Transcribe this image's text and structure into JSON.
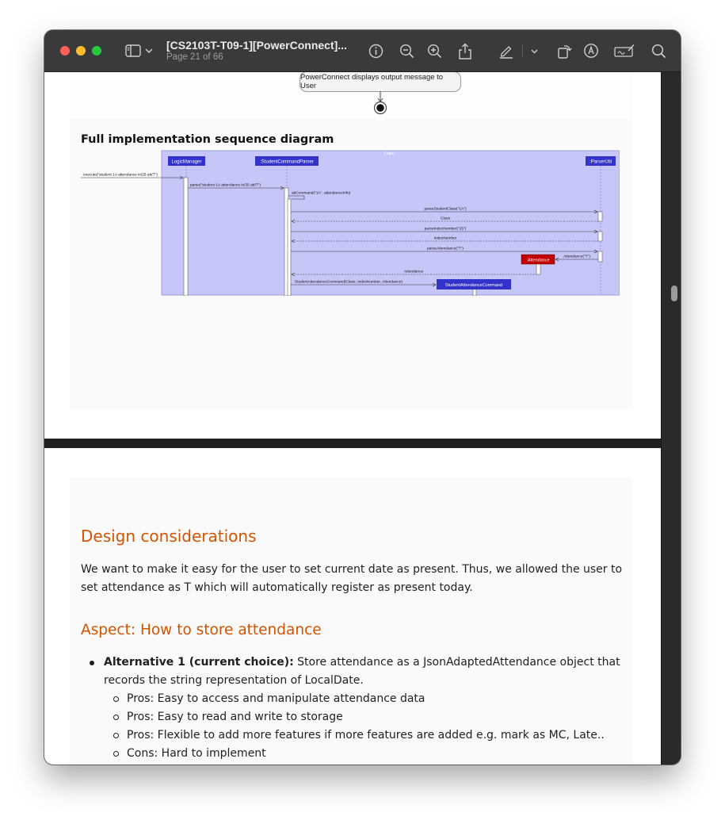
{
  "window": {
    "title": "[CS2103T-T09-1][PowerConnect]...",
    "subtitle": "Page 21 of 66"
  },
  "toolbar": {
    "icons": [
      "sidebar-icon",
      "chevron-down-icon",
      "info-icon",
      "zoom-out-icon",
      "zoom-in-icon",
      "share-icon",
      "highlight-pen-icon",
      "chevron-down-icon",
      "rotate-icon",
      "markup-icon",
      "signature-icon",
      "search-icon"
    ]
  },
  "page1": {
    "activity_node": "PowerConnect displays output message to User",
    "heading": "Full implementation sequence diagram"
  },
  "sequence": {
    "frame_label": "Logic",
    "participants": [
      "LogicManager",
      ":StudentCommandParser",
      ":ParserUtil"
    ],
    "messages": [
      "execute(\"student 1A attendance in/25 att/T\")",
      "parse(\"student 1A attendance in/25 att/T\")",
      "attCommand(\"1A\", attendanceInfo)",
      "parseStudentClass(\"1A\")",
      "Class",
      "parseIndexNumber(\"25\")",
      "IndexNumber",
      "parseAttendance(\"T\")",
      "Attendance(\"T\")",
      "Attendance",
      "StudentAttendanceCommand(Class, IndexNumber, Attendance)"
    ],
    "created_objects": [
      ":Attendance",
      "StudentAttendanceCommand"
    ]
  },
  "page2": {
    "section_heading": "Design considerations",
    "intro": "We want to make it easy for the user to set current date as present. Thus, we allowed the user to set attendance as T which will automatically register as present today.",
    "aspect_heading": "Aspect: How to store attendance",
    "alternative_label": "Alternative 1 (current choice):",
    "alternative_text": " Store attendance as a JsonAdaptedAttendance object that records the string representation of LocalDate.",
    "sub_items": [
      "Pros: Easy to access and manipulate attendance data",
      "Pros: Easy to read and write to storage",
      "Pros: Flexible to add more features if more features are added e.g. mark as MC, Late..",
      "Cons: Hard to implement"
    ]
  },
  "colors": {
    "frame_bg": "#c6c6f9",
    "participant_bg": "#3333cc",
    "attendance_bg": "#c00000",
    "heading_orange": "#d35400"
  }
}
